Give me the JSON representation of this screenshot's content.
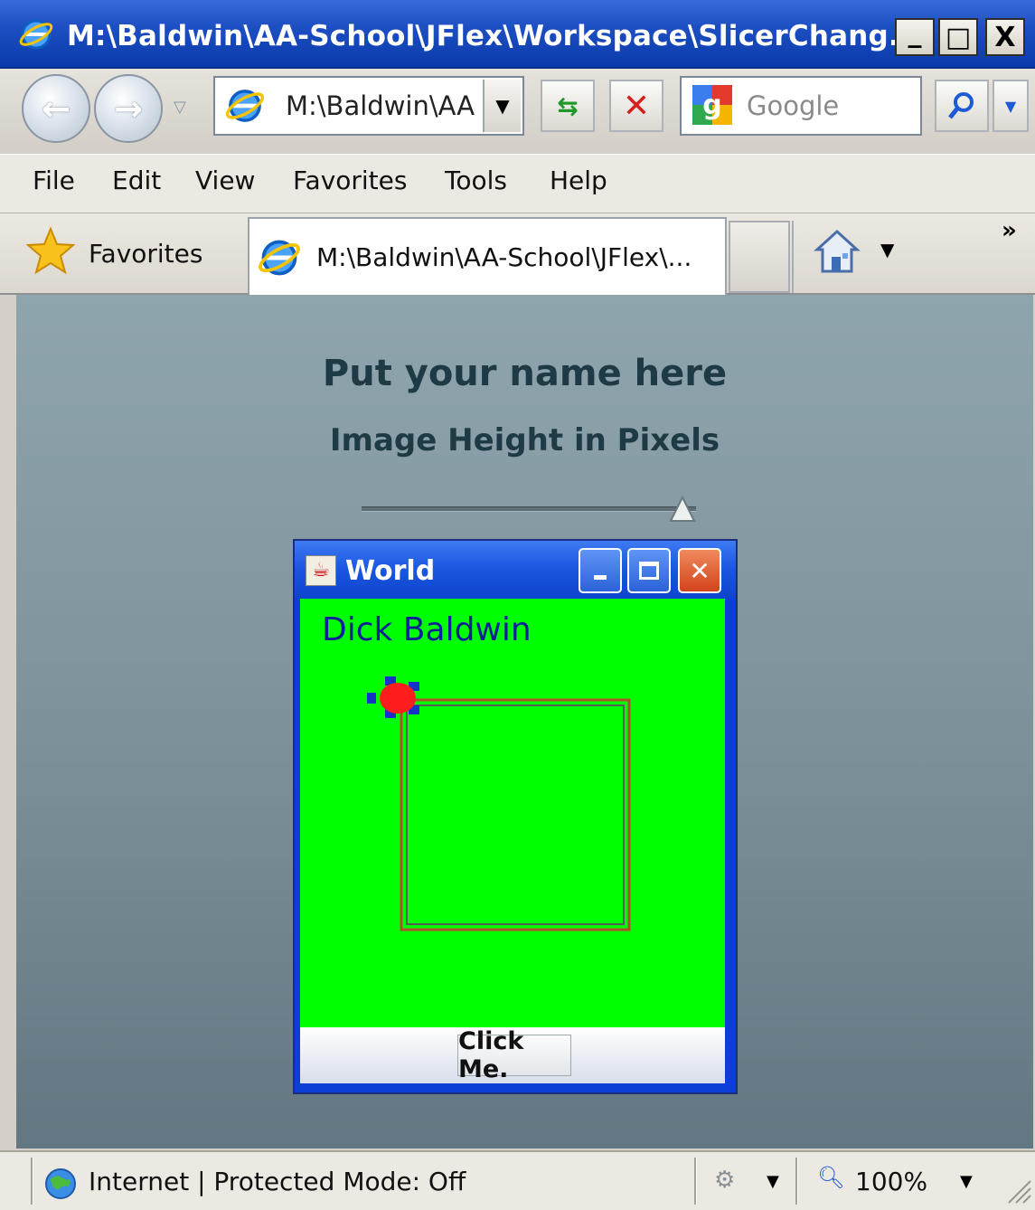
{
  "window": {
    "title": "M:\\Baldwin\\AA-School\\JFlex\\Workspace\\SlicerChang...",
    "minimize": "_",
    "maximize": "□",
    "close": "X"
  },
  "nav": {
    "address": "M:\\Baldwin\\AA",
    "search_placeholder": "Google"
  },
  "menu": [
    "File",
    "Edit",
    "View",
    "Favorites",
    "Tools",
    "Help"
  ],
  "favorites_bar": {
    "favorites_label": "Favorites",
    "tab_title": "M:\\Baldwin\\AA-School\\JFlex\\...",
    "more": "»"
  },
  "page": {
    "heading": "Put your name here",
    "subheading": "Image Height in Pixels",
    "slider_value_fraction": 1.0
  },
  "java_window": {
    "title": "World",
    "label": "Dick Baldwin",
    "button": "Click Me."
  },
  "status": {
    "zone_text": "Internet | Protected Mode: Off",
    "zoom": "100%"
  },
  "colors": {
    "titlebar": "#1d4fc4",
    "page_bg": "#7e929b",
    "java_green": "#00ff00",
    "java_label": "#0a1f98"
  }
}
